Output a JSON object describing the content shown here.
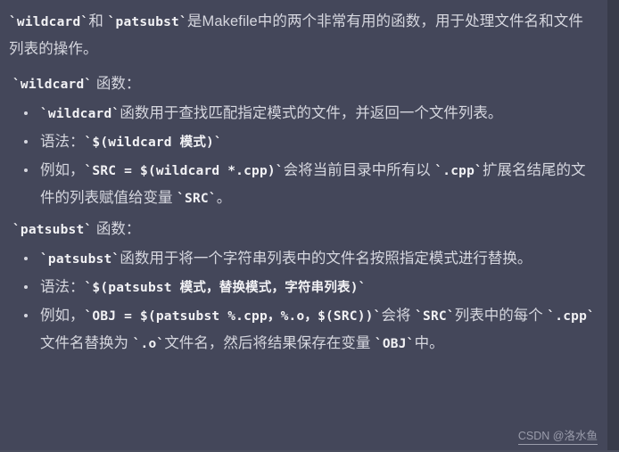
{
  "theme": {
    "background": "#44475a",
    "gutter": "#383b4a",
    "text_color": "#d6d7df",
    "code_color": "#f2f2f5",
    "watermark_color": "#9a9cab"
  },
  "document": {
    "intro": {
      "code_1": "`wildcard`",
      "mid_1": "和 ",
      "code_2": "`patsubst`",
      "tail": "是Makefile中的两个非常有用的函数，用于处理文件名和文件列表的操作。"
    },
    "sections": [
      {
        "heading_code": "`wildcard`",
        "heading_text": " 函数：",
        "items": [
          {
            "segments": [
              {
                "type": "code",
                "text": "`wildcard`"
              },
              {
                "type": "text",
                "text": "函数用于查找匹配指定模式的文件，并返回一个文件列表。"
              }
            ]
          },
          {
            "segments": [
              {
                "type": "text",
                "text": "语法："
              },
              {
                "type": "code",
                "text": "`$(wildcard 模式)`"
              }
            ]
          },
          {
            "segments": [
              {
                "type": "text",
                "text": "例如，"
              },
              {
                "type": "code",
                "text": "`SRC = $(wildcard *.cpp)`"
              },
              {
                "type": "text",
                "text": "会将当前目录中所有以 "
              },
              {
                "type": "code",
                "text": "`.cpp`"
              },
              {
                "type": "text",
                "text": "扩展名结尾的文件的列表赋值给变量 "
              },
              {
                "type": "code",
                "text": "`SRC`"
              },
              {
                "type": "text",
                "text": "。"
              }
            ]
          }
        ]
      },
      {
        "heading_code": "`patsubst`",
        "heading_text": " 函数：",
        "items": [
          {
            "segments": [
              {
                "type": "code",
                "text": "`patsubst`"
              },
              {
                "type": "text",
                "text": "函数用于将一个字符串列表中的文件名按照指定模式进行替换。"
              }
            ]
          },
          {
            "segments": [
              {
                "type": "text",
                "text": "语法："
              },
              {
                "type": "code",
                "text": "`$(patsubst 模式，替换模式，字符串列表)`"
              }
            ]
          },
          {
            "segments": [
              {
                "type": "text",
                "text": "例如，"
              },
              {
                "type": "code",
                "text": "`OBJ = $(patsubst %.cpp，%.o，$(SRC))`"
              },
              {
                "type": "text",
                "text": "会将 "
              },
              {
                "type": "code",
                "text": "`SRC`"
              },
              {
                "type": "text",
                "text": "列表中的每个 "
              },
              {
                "type": "code",
                "text": "`.cpp`"
              },
              {
                "type": "text",
                "text": "文件名替换为 "
              },
              {
                "type": "code",
                "text": "`.o`"
              },
              {
                "type": "text",
                "text": "文件名，然后将结果保存在变量 "
              },
              {
                "type": "code",
                "text": "`OBJ`"
              },
              {
                "type": "text",
                "text": "中。"
              }
            ]
          }
        ]
      }
    ],
    "watermark": "CSDN @洛水鱼"
  }
}
